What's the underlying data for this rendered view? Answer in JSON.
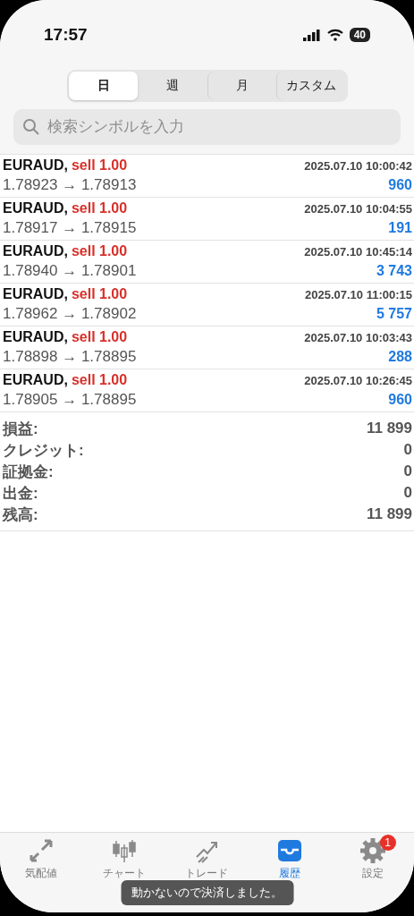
{
  "status_bar": {
    "time": "17:57",
    "battery": "40"
  },
  "period_tabs": [
    {
      "label": "日",
      "selected": true
    },
    {
      "label": "週",
      "selected": false
    },
    {
      "label": "月",
      "selected": false
    },
    {
      "label": "カスタム",
      "selected": false
    }
  ],
  "search": {
    "placeholder": "検索シンボルを入力"
  },
  "deals": [
    {
      "symbol": "EURAUD,",
      "side": "sell 1.00",
      "time": "2025.07.10 10:00:42",
      "prices": "1.78923 → 1.78913",
      "profit": "960"
    },
    {
      "symbol": "EURAUD,",
      "side": "sell 1.00",
      "time": "2025.07.10 10:04:55",
      "prices": "1.78917 → 1.78915",
      "profit": "191"
    },
    {
      "symbol": "EURAUD,",
      "side": "sell 1.00",
      "time": "2025.07.10 10:45:14",
      "prices": "1.78940 → 1.78901",
      "profit": "3 743"
    },
    {
      "symbol": "EURAUD,",
      "side": "sell 1.00",
      "time": "2025.07.10 11:00:15",
      "prices": "1.78962 → 1.78902",
      "profit": "5 757"
    },
    {
      "symbol": "EURAUD,",
      "side": "sell 1.00",
      "time": "2025.07.10 10:03:43",
      "prices": "1.78898 → 1.78895",
      "profit": "288"
    },
    {
      "symbol": "EURAUD,",
      "side": "sell 1.00",
      "time": "2025.07.10 10:26:45",
      "prices": "1.78905 → 1.78895",
      "profit": "960"
    }
  ],
  "summary": [
    {
      "label": "損益:",
      "value": "11 899"
    },
    {
      "label": "クレジット:",
      "value": "0"
    },
    {
      "label": "証拠金:",
      "value": "0"
    },
    {
      "label": "出金:",
      "value": "0"
    },
    {
      "label": "残高:",
      "value": "11 899"
    }
  ],
  "tab_bar": [
    {
      "kind": "quotes",
      "label": "気配値",
      "selected": false
    },
    {
      "kind": "chart",
      "label": "チャート",
      "selected": false
    },
    {
      "kind": "trade",
      "label": "トレード",
      "selected": false
    },
    {
      "kind": "history",
      "label": "履歴",
      "selected": true
    },
    {
      "kind": "settings",
      "label": "設定",
      "selected": false,
      "badge": "1"
    }
  ],
  "toast": "動かないので決済しました。"
}
